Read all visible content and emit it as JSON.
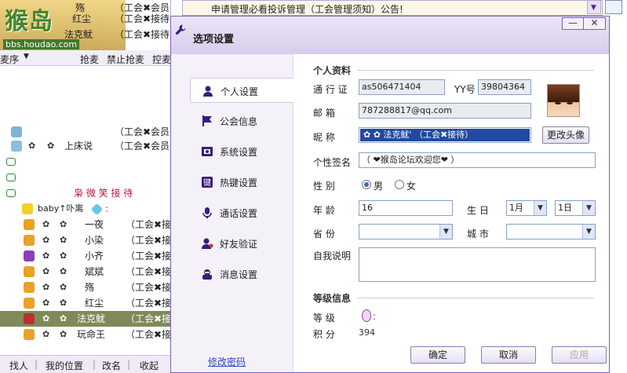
{
  "background": {
    "logo": {
      "text": "猴岛",
      "url": "bbs.houdao.com"
    },
    "top_rows": [
      {
        "name": "殇",
        "tag": "（工会✖会员"
      },
      {
        "name": "红尘",
        "tag": "（工会✖接待"
      },
      {
        "name": "法克鱿",
        "tag": "（工会✖接待"
      }
    ],
    "toolbar": {
      "sort": "麦序",
      "grab": "抢麦",
      "ban": "禁止抢麦",
      "ctrl": "控麦"
    },
    "list_top_rows": [
      {
        "name": "",
        "tag": "（工会✖会员"
      },
      {
        "name": "上床说",
        "tag": "（工会✖会员"
      }
    ],
    "group_header": "枭  微 笑 接 待",
    "baby_row": {
      "name": "baby↑卟离",
      "suffix": ":"
    },
    "member_rows": [
      {
        "name": "一夜",
        "tag": "（工会✖接"
      },
      {
        "name": "小染",
        "tag": "（工会✖接"
      },
      {
        "name": "小齐",
        "tag": "（工会✖接"
      },
      {
        "name": "斌斌",
        "tag": "（工会✖接"
      },
      {
        "name": "殇",
        "tag": "（工会✖接"
      },
      {
        "name": "红尘",
        "tag": "（工会✖接"
      },
      {
        "name": "法克鱿",
        "tag": "（工会✖接"
      },
      {
        "name": "玩命王",
        "tag": "（工会✖接"
      }
    ],
    "bottom_bar": {
      "find": "找人",
      "my_pos": "我的位置",
      "rename": "改名",
      "collapse": "收起"
    },
    "notice": "申请管理必看投诉管理（工会管理须知）公告!"
  },
  "dialog": {
    "title": "选项设置",
    "min_label": "—",
    "close_label": "✕",
    "nav": [
      {
        "label": "个人设置",
        "icon": "person-icon",
        "active": true
      },
      {
        "label": "公会信息",
        "icon": "flag-icon",
        "active": false
      },
      {
        "label": "系统设置",
        "icon": "settings-icon",
        "active": false
      },
      {
        "label": "热键设置",
        "icon": "key-icon",
        "active": false
      },
      {
        "label": "通话设置",
        "icon": "microphone-icon",
        "active": false
      },
      {
        "label": "好友验证",
        "icon": "friend-icon",
        "active": false
      },
      {
        "label": "消息设置",
        "icon": "message-icon",
        "active": false
      }
    ],
    "change_password": "修改密码",
    "profile": {
      "section_title": "个人资料",
      "passport_label": "通 行 证",
      "passport_value": "as506471404",
      "yy_label": "YY号",
      "yy_value": "39804364",
      "email_label": "邮    箱",
      "email_value": "787288817@qq.com",
      "nick_label": "昵    称",
      "nick_value": "✿  ✿   法克鱿'  （工会✖接待）",
      "change_avatar": "更改头像",
      "signature_label": "个性签名",
      "signature_value": "（ ❤猴岛论坛欢迎您❤ ）",
      "gender_label": "性    别",
      "gender_male": "男",
      "gender_female": "女",
      "gender_selected": "male",
      "age_label": "年    龄",
      "age_value": "16",
      "birthday_label": "生  日",
      "birth_month": "1月",
      "birth_day": "1日",
      "province_label": "省    份",
      "province_value": "",
      "city_label": "城  市",
      "city_value": "",
      "about_label": "自我说明",
      "about_value": ""
    },
    "level": {
      "section_title": "等级信息",
      "level_label": "等    级",
      "level_suffix": ":",
      "points_label": "积    分",
      "points_value": "394"
    },
    "buttons": {
      "ok": "确定",
      "cancel": "取消",
      "apply": "应用"
    }
  }
}
